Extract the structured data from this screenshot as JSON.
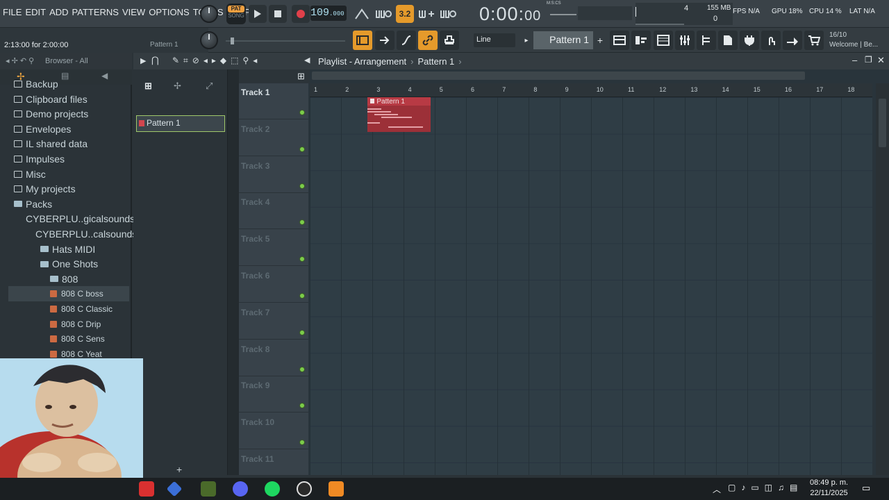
{
  "menu": [
    "FILE",
    "EDIT",
    "ADD",
    "PATTERNS",
    "VIEW",
    "OPTIONS",
    "TOOLS",
    "HELP"
  ],
  "transport": {
    "pat_label": "PAT",
    "song_label": "SONG",
    "tempo_value": "109",
    "tempo_decimal": ".000",
    "time_display": "0:00:",
    "time_small": "00",
    "time_unit": "M:S:CS",
    "hint_value": "3.2"
  },
  "status": {
    "memory_value": "4",
    "memory_mb": "155 MB",
    "memory_zero": "0",
    "fps_label": "FPS N/A",
    "gpu_label": "GPU 18%",
    "cpu_label": "CPU 14 %",
    "lat_label": "LAT N/A"
  },
  "hint_bar": {
    "text": "2:13:00 for 2:00:00",
    "pattern_text": "Pattern 1"
  },
  "snap": {
    "value": "Line"
  },
  "pattern_selector": {
    "value": "Pattern 1"
  },
  "news": {
    "date": "16/10",
    "text": "Welcome | Be..."
  },
  "browser": {
    "title": "Browser - All",
    "items": [
      {
        "label": "Backup",
        "type": "folder",
        "indent": 0
      },
      {
        "label": "Clipboard files",
        "type": "folder",
        "indent": 0
      },
      {
        "label": "Demo projects",
        "type": "folder",
        "indent": 0
      },
      {
        "label": "Envelopes",
        "type": "folder",
        "indent": 0
      },
      {
        "label": "IL shared data",
        "type": "folder",
        "indent": 0
      },
      {
        "label": "Impulses",
        "type": "folder",
        "indent": 0
      },
      {
        "label": "Misc",
        "type": "folder",
        "indent": 0
      },
      {
        "label": "My projects",
        "type": "folder",
        "indent": 0
      },
      {
        "label": "Packs",
        "type": "folder-open",
        "indent": 0
      },
      {
        "label": "CYBERPLU..gicalsounds",
        "type": "folder-open",
        "indent": 1
      },
      {
        "label": "CYBERPLU..calsounds",
        "type": "folder-open",
        "indent": 2
      },
      {
        "label": "Hats MIDI",
        "type": "folder-open",
        "indent": 3
      },
      {
        "label": "One Shots",
        "type": "folder-open",
        "indent": 3
      },
      {
        "label": "808",
        "type": "folder-open",
        "indent": 4
      },
      {
        "label": "808 C boss",
        "type": "file",
        "indent": 5,
        "selected": true
      },
      {
        "label": "808 C Classic",
        "type": "file",
        "indent": 5
      },
      {
        "label": "808 C Drip",
        "type": "file",
        "indent": 5
      },
      {
        "label": "808 C Sens",
        "type": "file",
        "indent": 5
      },
      {
        "label": "808 C Yeat",
        "type": "file",
        "indent": 5
      }
    ]
  },
  "playlist": {
    "title": "Playlist - Arrangement",
    "pattern": "Pattern 1",
    "patterns": [
      "Pattern 1"
    ],
    "ruler": [
      "1",
      "2",
      "3",
      "4",
      "5",
      "6",
      "7",
      "8",
      "9",
      "10",
      "11",
      "12",
      "13",
      "14",
      "15",
      "16",
      "17",
      "18"
    ],
    "tracks": [
      "Track 1",
      "Track 2",
      "Track 3",
      "Track 4",
      "Track 5",
      "Track 6",
      "Track 7",
      "Track 8",
      "Track 9",
      "Track 10",
      "Track 11"
    ],
    "clip": {
      "label": "Pattern 1",
      "start_bar": 2.8,
      "length_bars": 2
    }
  },
  "taskbar": {
    "time": "08:49 p. m.",
    "date": "22/11/2025"
  }
}
